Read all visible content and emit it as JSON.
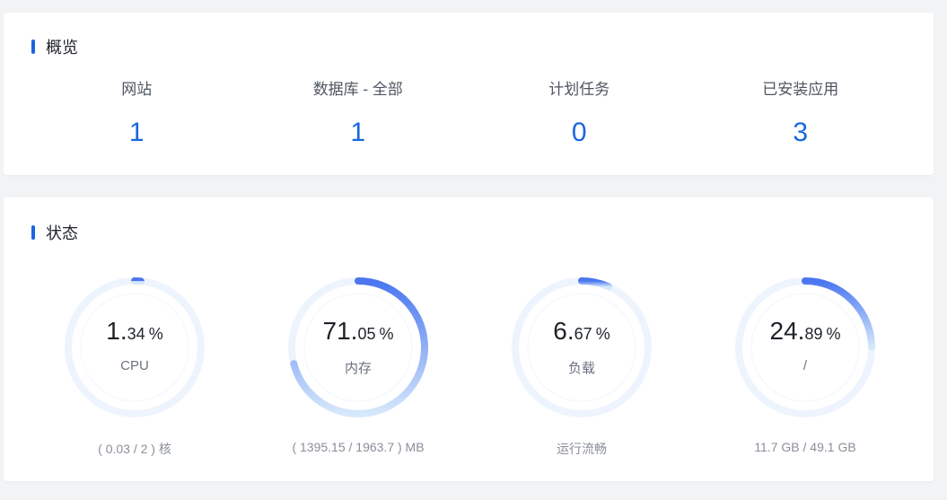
{
  "overview": {
    "title": "概览",
    "items": [
      {
        "label": "网站",
        "value": "1"
      },
      {
        "label": "数据库 - 全部",
        "value": "1"
      },
      {
        "label": "计划任务",
        "value": "0"
      },
      {
        "label": "已安装应用",
        "value": "3"
      }
    ]
  },
  "status": {
    "title": "状态",
    "gauges": [
      {
        "int": "1.",
        "dec": "34",
        "unit": "%",
        "label": "CPU",
        "detail": "( 0.03 / 2 ) 核",
        "percent": 1.34
      },
      {
        "int": "71.",
        "dec": "05",
        "unit": "%",
        "label": "内存",
        "detail": "( 1395.15 / 1963.7 ) MB",
        "percent": 71.05
      },
      {
        "int": "6.",
        "dec": "67",
        "unit": "%",
        "label": "负载",
        "detail": "运行流畅",
        "percent": 6.67
      },
      {
        "int": "24.",
        "dec": "89",
        "unit": "%",
        "label": "/",
        "detail": "11.7 GB / 49.1 GB",
        "percent": 24.89
      }
    ]
  },
  "colors": {
    "accent": "#1a66e0",
    "gauge_track": "#eef4fd",
    "gauge_start": "#4a76f0",
    "gauge_end": "#d6e8fb"
  }
}
